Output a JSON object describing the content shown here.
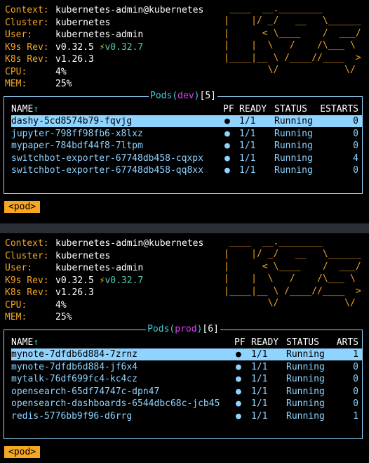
{
  "header_labels": {
    "context": "Context:",
    "cluster": "Cluster:",
    "user": "User:",
    "k9s_rev": "K9s Rev:",
    "k8s_rev": "K8s Rev:",
    "cpu": "CPU:",
    "mem": "MEM:"
  },
  "logo_ascii": " ____  __.________\n|    |/ _/   __   \\______\n|      < \\____    /  ___/\n|    |  \\   /    /\\___ \\\n|____|__ \\ /____//____  >\n        \\/            \\/",
  "colors": {
    "label": "#f5a623",
    "table_text": "#8fd3ff",
    "selected_row_bg": "#8fd3ff",
    "namespace": "#e040fb",
    "divider": "#2a2d33"
  },
  "panels": [
    {
      "header": {
        "context": "kubernetes-admin@kubernetes",
        "cluster": "kubernetes",
        "user": "kubernetes-admin",
        "k9s_rev": "v0.32.5",
        "k9s_bolt": "⚡",
        "k9s_latest": "v0.32.7",
        "k8s_rev": "v1.26.3",
        "cpu": "4%",
        "mem": "25%"
      },
      "title": {
        "resource": "Pods",
        "namespace": "dev",
        "count": "5"
      },
      "columns": {
        "name": "NAME",
        "sort_arrow": "↑",
        "pf": "PF",
        "ready": "READY",
        "status": "STATUS",
        "restarts": "ESTARTS"
      },
      "rows": [
        {
          "name": "dashy-5cd8574b79-fqvjg",
          "pf": "●",
          "ready": "1/1",
          "status": "Running",
          "restarts": "0"
        },
        {
          "name": "jupyter-798ff98fb6-x8lxz",
          "pf": "●",
          "ready": "1/1",
          "status": "Running",
          "restarts": "0"
        },
        {
          "name": "mypaper-784bdf44f8-7ltpm",
          "pf": "●",
          "ready": "1/1",
          "status": "Running",
          "restarts": "0"
        },
        {
          "name": "switchbot-exporter-67748db458-cqxpx",
          "pf": "●",
          "ready": "1/1",
          "status": "Running",
          "restarts": "4"
        },
        {
          "name": "switchbot-exporter-67748db458-qq8xx",
          "pf": "●",
          "ready": "1/1",
          "status": "Running",
          "restarts": "0"
        }
      ],
      "selected_row": 0,
      "crumb": "<pod>"
    },
    {
      "header": {
        "context": "kubernetes-admin@kubernetes",
        "cluster": "kubernetes",
        "user": "kubernetes-admin",
        "k9s_rev": "v0.32.5",
        "k9s_bolt": "⚡",
        "k9s_latest": "v0.32.7",
        "k8s_rev": "v1.26.3",
        "cpu": "4%",
        "mem": "25%"
      },
      "title": {
        "resource": "Pods",
        "namespace": "prod",
        "count": "6"
      },
      "columns": {
        "name": "NAME",
        "sort_arrow": "↑",
        "pf": "PF",
        "ready": "READY",
        "status": "STATUS",
        "restarts": "ARTS"
      },
      "rows": [
        {
          "name": "mynote-7dfdb6d884-7zrnz",
          "pf": "●",
          "ready": "1/1",
          "status": "Running",
          "restarts": "1"
        },
        {
          "name": "mynote-7dfdb6d884-jf6x4",
          "pf": "●",
          "ready": "1/1",
          "status": "Running",
          "restarts": "0"
        },
        {
          "name": "mytalk-76df699fc4-kc4cz",
          "pf": "●",
          "ready": "1/1",
          "status": "Running",
          "restarts": "0"
        },
        {
          "name": "opensearch-65df74747c-dpn47",
          "pf": "●",
          "ready": "1/1",
          "status": "Running",
          "restarts": "0"
        },
        {
          "name": "opensearch-dashboards-6544dbc68c-jcb45",
          "pf": "●",
          "ready": "1/1",
          "status": "Running",
          "restarts": "0"
        },
        {
          "name": "redis-5776bb9f96-d6rrg",
          "pf": "●",
          "ready": "1/1",
          "status": "Running",
          "restarts": "1"
        }
      ],
      "selected_row": 0,
      "crumb": "<pod>"
    }
  ]
}
